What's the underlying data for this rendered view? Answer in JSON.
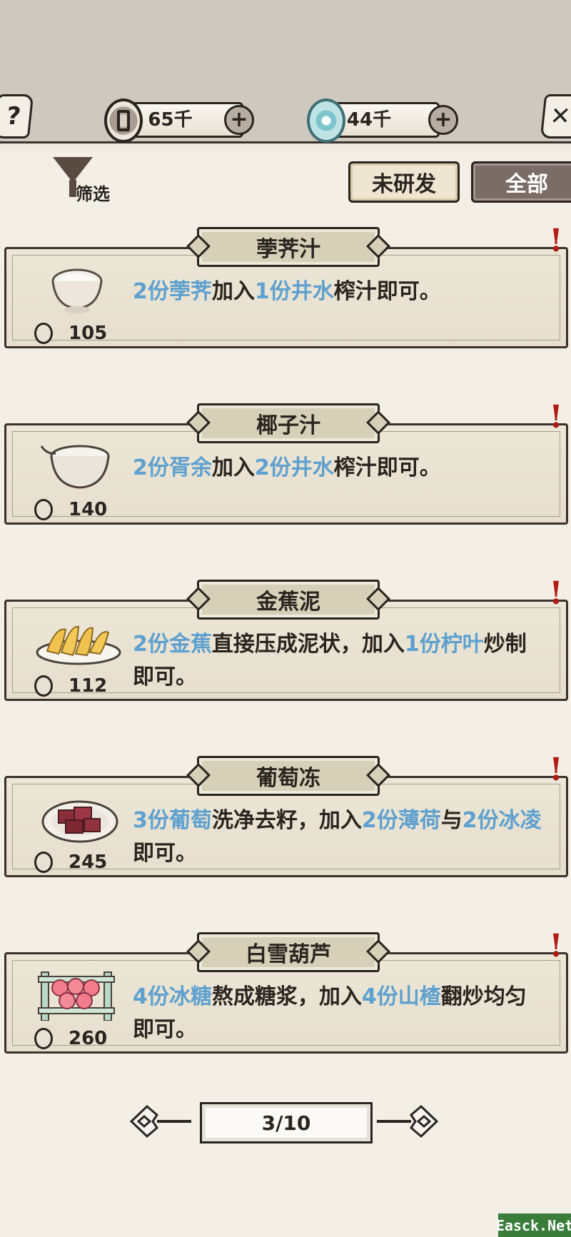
{
  "header": {
    "help_icon": "question-icon",
    "close_icon": "close-icon",
    "coin": {
      "icon": "coin-icon",
      "value": "65千"
    },
    "jade": {
      "icon": "jade-icon",
      "value": "44千"
    },
    "plus_label": "+"
  },
  "filter": {
    "icon": "funnel-icon",
    "label": "筛选"
  },
  "tabs": [
    {
      "label": "未研发",
      "selected": false
    },
    {
      "label": "全部",
      "selected": true
    }
  ],
  "recipes": [
    {
      "name": "荸荠汁",
      "icon": "milk-bowl-icon",
      "price": "105",
      "desc": [
        {
          "t": "2份荸荠",
          "hl": true
        },
        {
          "t": "加入",
          "hl": false
        },
        {
          "t": "1份井水",
          "hl": true
        },
        {
          "t": "榨汁即可。",
          "hl": false
        }
      ]
    },
    {
      "name": "椰子汁",
      "icon": "coconut-bowl-icon",
      "price": "140",
      "desc": [
        {
          "t": "2份胥余",
          "hl": true
        },
        {
          "t": "加入",
          "hl": false
        },
        {
          "t": "2份井水",
          "hl": true
        },
        {
          "t": "榨汁即可。",
          "hl": false
        }
      ]
    },
    {
      "name": "金蕉泥",
      "icon": "banana-plate-icon",
      "price": "112",
      "desc": [
        {
          "t": "2份金蕉",
          "hl": true
        },
        {
          "t": "直接压成泥状，加入",
          "hl": false
        },
        {
          "t": "1份柠叶",
          "hl": true
        },
        {
          "t": "炒制即可。",
          "hl": false
        }
      ]
    },
    {
      "name": "葡萄冻",
      "icon": "grape-jelly-plate-icon",
      "price": "245",
      "desc": [
        {
          "t": "3份葡萄",
          "hl": true
        },
        {
          "t": "洗净去籽，加入",
          "hl": false
        },
        {
          "t": "2份薄荷",
          "hl": true
        },
        {
          "t": "与",
          "hl": false
        },
        {
          "t": "2份冰凌",
          "hl": true
        },
        {
          "t": "即可。",
          "hl": false
        }
      ]
    },
    {
      "name": "白雪葫芦",
      "icon": "candied-haws-icon",
      "price": "260",
      "desc": [
        {
          "t": "4份冰糖",
          "hl": true
        },
        {
          "t": "熬成糖浆，加入",
          "hl": false
        },
        {
          "t": "4份山楂",
          "hl": true
        },
        {
          "t": "翻炒均匀即可。",
          "hl": false
        }
      ]
    }
  ],
  "alert_mark": "!",
  "pager": {
    "current": "3/10"
  },
  "watermark": "Easck.Net",
  "colors": {
    "highlight": "#5ea0cf",
    "alert": "#b01b14",
    "tab_selected_bg": "#7a6c66"
  }
}
